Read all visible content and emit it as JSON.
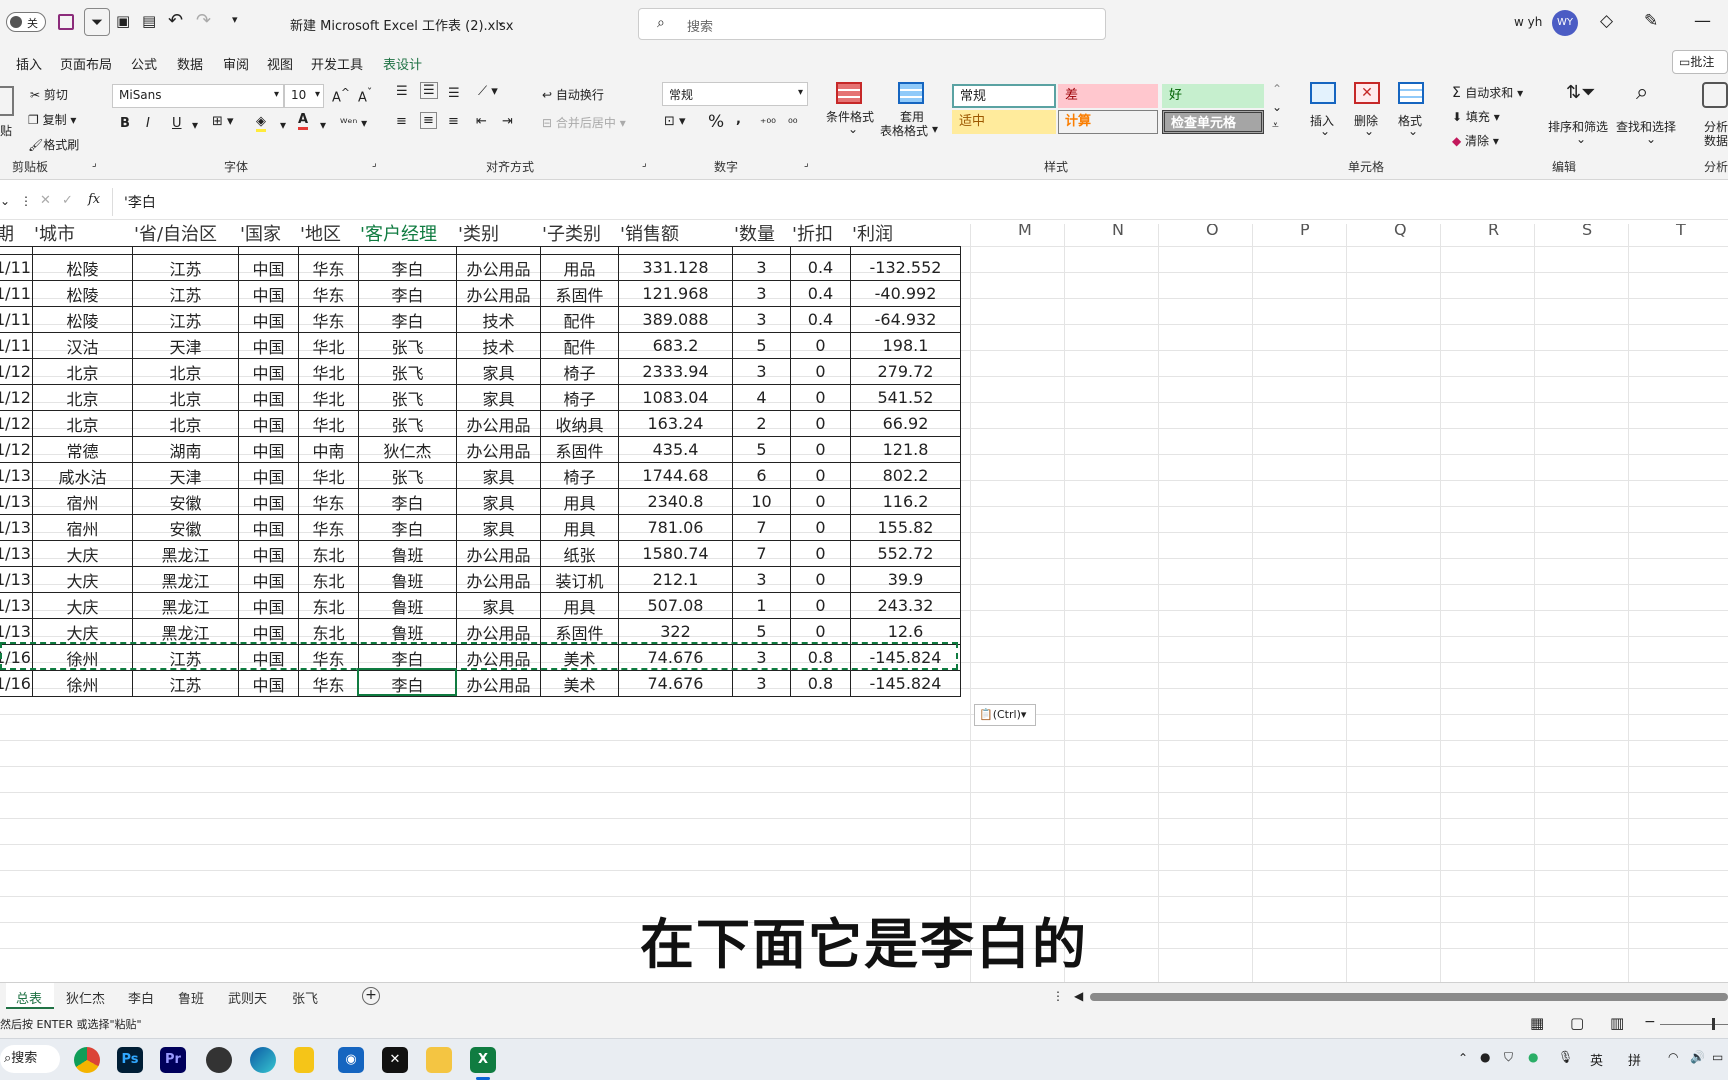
{
  "titlebar": {
    "autosave_label": "关",
    "filename": "新建 Microsoft Excel 工作表 (2).xlsx",
    "search_placeholder": "搜索",
    "user_name": "w yh",
    "avatar_initials": "WY"
  },
  "menu": {
    "items": [
      "插入",
      "页面布局",
      "公式",
      "数据",
      "审阅",
      "视图",
      "开发工具",
      "表设计"
    ],
    "comments_label": "批注"
  },
  "ribbon": {
    "clipboard": {
      "paste": "贴",
      "cut": "剪切",
      "copy": "复制",
      "format_painter": "格式刷",
      "group": "剪贴板"
    },
    "font": {
      "name": "MiSans",
      "size": "10",
      "bold": "B",
      "italic": "I",
      "underline": "U",
      "group": "字体"
    },
    "alignment": {
      "wrap": "自动换行",
      "merge": "合并后居中",
      "group": "对齐方式"
    },
    "number": {
      "format": "常规",
      "percent": "%",
      "group": "数字"
    },
    "styles": {
      "conditional": "条件格式",
      "table_format": "套用\n表格格式",
      "table_format_line1": "套用",
      "table_format_line2": "表格格式",
      "cells": [
        "常规",
        "差",
        "好",
        "适中",
        "计算",
        "检查单元格"
      ],
      "group": "样式"
    },
    "cells": {
      "insert": "插入",
      "delete": "删除",
      "format": "格式",
      "group": "单元格"
    },
    "editing": {
      "autosum": "自动求和",
      "fill": "填充",
      "clear": "清除",
      "sort_filter": "排序和筛选",
      "find_select": "查找和选择",
      "group": "编辑"
    },
    "analysis": {
      "label1": "分析",
      "label2": "数据",
      "group": "分析"
    }
  },
  "formula_bar": {
    "fx": "fx",
    "value": "'李白"
  },
  "grid": {
    "headers": [
      "期",
      "'城市",
      "'省/自治区",
      "'国家",
      "'地区",
      "'客户经理",
      "'类别",
      "'子类别",
      "'销售额",
      "'数量",
      "'折扣",
      "'利润"
    ],
    "extra_columns": [
      "M",
      "N",
      "O",
      "P",
      "Q",
      "R",
      "S",
      "T"
    ],
    "rows": [
      [
        "1/11",
        "松陵",
        "江苏",
        "中国",
        "华东",
        "李白",
        "办公用品",
        "用品",
        "331.128",
        "3",
        "0.4",
        "-132.552"
      ],
      [
        "1/11",
        "松陵",
        "江苏",
        "中国",
        "华东",
        "李白",
        "办公用品",
        "系固件",
        "121.968",
        "3",
        "0.4",
        "-40.992"
      ],
      [
        "1/11",
        "松陵",
        "江苏",
        "中国",
        "华东",
        "李白",
        "技术",
        "配件",
        "389.088",
        "3",
        "0.4",
        "-64.932"
      ],
      [
        "1/11",
        "汉沽",
        "天津",
        "中国",
        "华北",
        "张飞",
        "技术",
        "配件",
        "683.2",
        "5",
        "0",
        "198.1"
      ],
      [
        "1/12",
        "北京",
        "北京",
        "中国",
        "华北",
        "张飞",
        "家具",
        "椅子",
        "2333.94",
        "3",
        "0",
        "279.72"
      ],
      [
        "1/12",
        "北京",
        "北京",
        "中国",
        "华北",
        "张飞",
        "家具",
        "椅子",
        "1083.04",
        "4",
        "0",
        "541.52"
      ],
      [
        "1/12",
        "北京",
        "北京",
        "中国",
        "华北",
        "张飞",
        "办公用品",
        "收纳具",
        "163.24",
        "2",
        "0",
        "66.92"
      ],
      [
        "1/12",
        "常德",
        "湖南",
        "中国",
        "中南",
        "狄仁杰",
        "办公用品",
        "系固件",
        "435.4",
        "5",
        "0",
        "121.8"
      ],
      [
        "1/13",
        "咸水沽",
        "天津",
        "中国",
        "华北",
        "张飞",
        "家具",
        "椅子",
        "1744.68",
        "6",
        "0",
        "802.2"
      ],
      [
        "1/13",
        "宿州",
        "安徽",
        "中国",
        "华东",
        "李白",
        "家具",
        "用具",
        "2340.8",
        "10",
        "0",
        "116.2"
      ],
      [
        "1/13",
        "宿州",
        "安徽",
        "中国",
        "华东",
        "李白",
        "家具",
        "用具",
        "781.06",
        "7",
        "0",
        "155.82"
      ],
      [
        "1/13",
        "大庆",
        "黑龙江",
        "中国",
        "东北",
        "鲁班",
        "办公用品",
        "纸张",
        "1580.74",
        "7",
        "0",
        "552.72"
      ],
      [
        "1/13",
        "大庆",
        "黑龙江",
        "中国",
        "东北",
        "鲁班",
        "办公用品",
        "装订机",
        "212.1",
        "3",
        "0",
        "39.9"
      ],
      [
        "1/13",
        "大庆",
        "黑龙江",
        "中国",
        "东北",
        "鲁班",
        "家具",
        "用具",
        "507.08",
        "1",
        "0",
        "243.32"
      ],
      [
        "1/13",
        "大庆",
        "黑龙江",
        "中国",
        "东北",
        "鲁班",
        "办公用品",
        "系固件",
        "322",
        "5",
        "0",
        "12.6"
      ],
      [
        "1/16",
        "徐州",
        "江苏",
        "中国",
        "华东",
        "李白",
        "办公用品",
        "美术",
        "74.676",
        "3",
        "0.8",
        "-145.824"
      ],
      [
        "1/16",
        "徐州",
        "江苏",
        "中国",
        "华东",
        "李白",
        "办公用品",
        "美术",
        "74.676",
        "3",
        "0.8",
        "-145.824"
      ]
    ],
    "paste_options_label": "(Ctrl)"
  },
  "subtitle": "在下面它是李白的",
  "sheet_tabs": [
    "总表",
    "狄仁杰",
    "李白",
    "鲁班",
    "武则天",
    "张飞"
  ],
  "status": {
    "message": "然后按 ENTER 或选择\"粘贴\""
  },
  "taskbar": {
    "search_label": "搜索",
    "ime_1": "英",
    "ime_2": "拼"
  },
  "colors": {
    "accent_green": "#217346",
    "selection_border": "#107c41",
    "subtitle": "#111111"
  }
}
